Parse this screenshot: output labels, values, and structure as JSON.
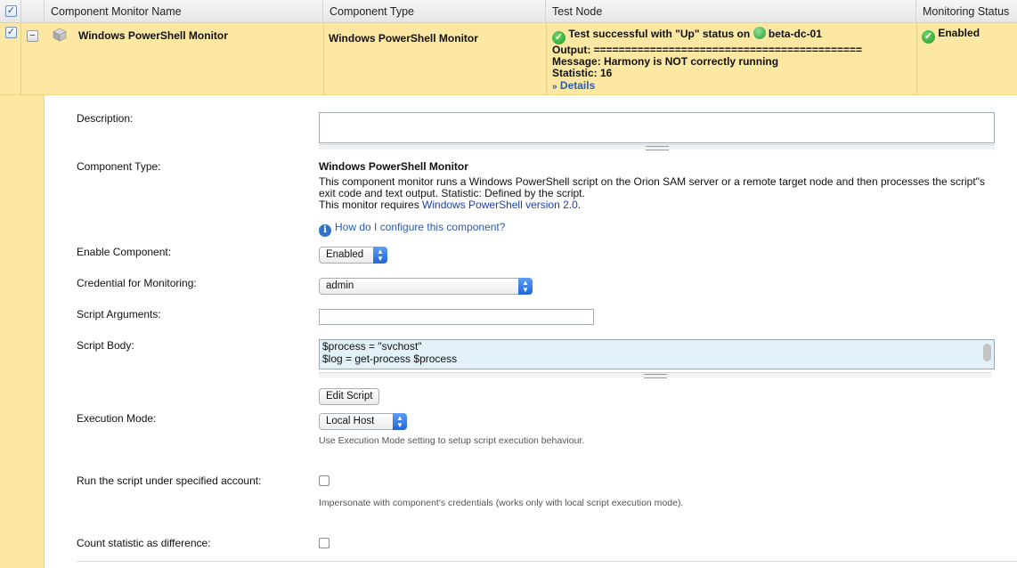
{
  "header": {
    "col_name": "Component Monitor Name",
    "col_type": "Component Type",
    "col_test": "Test Node",
    "col_status": "Monitoring Status"
  },
  "row": {
    "name": "Windows PowerShell Monitor",
    "type": "Windows PowerShell Monitor",
    "test_result": "Test successful with \"Up\" status on",
    "node_name": "beta-dc-01",
    "output": "Output: ===========================================",
    "message": "Message: Harmony is NOT correctly running",
    "statistic": "Statistic: 16",
    "details_prefix": "»",
    "details_link": "Details",
    "status": "Enabled"
  },
  "form": {
    "description_label": "Description:",
    "description_value": "",
    "component_type_label": "Component Type:",
    "component_type_title": "Windows PowerShell Monitor",
    "component_type_desc": "This component monitor runs a Windows PowerShell script on the Orion SAM server or a remote target node and then processes the script\"s exit code and text output. Statistic: Defined by the script.",
    "requires_prefix": "This monitor requires ",
    "requires_link": "Windows PowerShell version 2.0",
    "requires_suffix": ".",
    "help_link": "How do I configure this component?",
    "enable_label": "Enable Component:",
    "enable_value": "Enabled",
    "credential_label": "Credential for Monitoring:",
    "credential_value": "admin",
    "script_args_label": "Script Arguments:",
    "script_args_value": "",
    "script_body_label": "Script Body:",
    "script_body_line1": "$process = \"svchost\"",
    "script_body_line2": "$log = get-process $process",
    "edit_script_button": "Edit Script",
    "exec_mode_label": "Execution Mode:",
    "exec_mode_value": "Local Host",
    "exec_mode_hint": "Use Execution Mode setting to setup script execution behaviour.",
    "run_account_label": "Run the script under specified account:",
    "run_account_hint": "Impersonate with component's credentials (works only with local script execution mode).",
    "count_stat_label": "Count statistic as difference:"
  },
  "colors": {
    "selected_row": "#fce8a2",
    "link": "#1a3fb5",
    "ok_green": "#1f9a1f",
    "select_blue": "#1f65d6"
  },
  "icons": [
    "checkbox-checked-icon",
    "collapse-icon",
    "component-cube-icon",
    "status-ok-icon",
    "node-status-icon",
    "info-icon",
    "select-arrows-icon"
  ]
}
